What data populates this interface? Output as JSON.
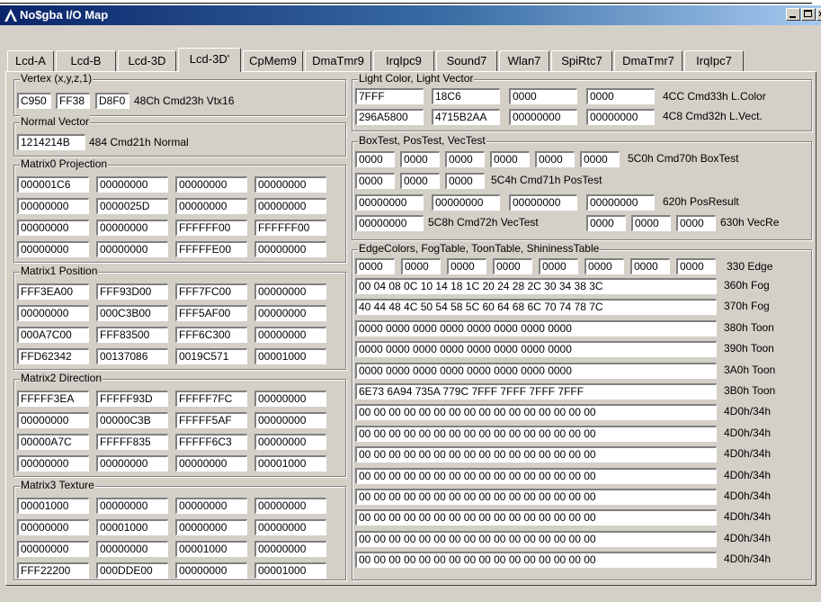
{
  "window": {
    "title": "No$gba I/O Map"
  },
  "tabs": [
    "Lcd-A",
    "Lcd-B",
    "Lcd-3D",
    "Lcd-3D'",
    "CpMem9",
    "DmaTmr9",
    "IrqIpc9",
    "Sound7",
    "Wlan7",
    "SpiRtc7",
    "DmaTmr7",
    "IrqIpc7"
  ],
  "active_tab": "Lcd-3D'",
  "vertex": {
    "title": "Vertex (x,y,z,1)",
    "values": [
      "C950",
      "FF38",
      "D8F0"
    ],
    "label": "48Ch Cmd23h Vtx16"
  },
  "normal": {
    "title": "Normal Vector",
    "value": "1214214B",
    "label": "484 Cmd21h Normal"
  },
  "matrix0": {
    "title": "Matrix0 Projection",
    "rows": [
      [
        "000001C6",
        "00000000",
        "00000000",
        "00000000"
      ],
      [
        "00000000",
        "0000025D",
        "00000000",
        "00000000"
      ],
      [
        "00000000",
        "00000000",
        "FFFFFF00",
        "FFFFFF00"
      ],
      [
        "00000000",
        "00000000",
        "FFFFFE00",
        "00000000"
      ]
    ]
  },
  "matrix1": {
    "title": "Matrix1 Position",
    "rows": [
      [
        "FFF3EA00",
        "FFF93D00",
        "FFF7FC00",
        "00000000"
      ],
      [
        "00000000",
        "000C3B00",
        "FFF5AF00",
        "00000000"
      ],
      [
        "000A7C00",
        "FFF83500",
        "FFF6C300",
        "00000000"
      ],
      [
        "FFD62342",
        "00137086",
        "0019C571",
        "00001000"
      ]
    ]
  },
  "matrix2": {
    "title": "Matrix2 Direction",
    "rows": [
      [
        "FFFFF3EA",
        "FFFFF93D",
        "FFFFF7FC",
        "00000000"
      ],
      [
        "00000000",
        "00000C3B",
        "FFFFF5AF",
        "00000000"
      ],
      [
        "00000A7C",
        "FFFFF835",
        "FFFFF6C3",
        "00000000"
      ],
      [
        "00000000",
        "00000000",
        "00000000",
        "00001000"
      ]
    ]
  },
  "matrix3": {
    "title": "Matrix3 Texture",
    "rows": [
      [
        "00001000",
        "00000000",
        "00000000",
        "00000000"
      ],
      [
        "00000000",
        "00001000",
        "00000000",
        "00000000"
      ],
      [
        "00000000",
        "00000000",
        "00001000",
        "00000000"
      ],
      [
        "FFF22200",
        "000DDE00",
        "00000000",
        "00001000"
      ]
    ]
  },
  "light": {
    "title": "Light Color, Light Vector",
    "row1": [
      "7FFF",
      "18C6",
      "0000",
      "0000"
    ],
    "row1_label": "4CC Cmd33h L.Color",
    "row2": [
      "296A5800",
      "4715B2AA",
      "00000000",
      "00000000"
    ],
    "row2_label": "4C8 Cmd32h L.Vect."
  },
  "boxtest": {
    "title": "BoxTest, PosTest, VecTest",
    "box": [
      "0000",
      "0000",
      "0000",
      "0000",
      "0000",
      "0000"
    ],
    "box_label": "5C0h Cmd70h BoxTest",
    "pos": [
      "0000",
      "0000",
      "0000"
    ],
    "pos_label": "5C4h Cmd71h PosTest",
    "posresult": [
      "00000000",
      "00000000",
      "00000000",
      "00000000"
    ],
    "posresult_label": "620h PosResult",
    "vec_in": "00000000",
    "vec_label": "5C8h Cmd72h VecTest",
    "vecresult": [
      "0000",
      "0000",
      "0000"
    ],
    "vecresult_label": "630h VecRe"
  },
  "edge": {
    "title": "EdgeColors, FogTable, ToonTable, ShininessTable",
    "colors": [
      "0000",
      "0000",
      "0000",
      "0000",
      "0000",
      "0000",
      "0000",
      "0000"
    ],
    "colors_label": "330 Edge",
    "rows": [
      {
        "value": "00 04 08 0C 10 14 18 1C 20 24 28 2C 30 34 38 3C",
        "label": "360h Fog"
      },
      {
        "value": "40 44 48 4C 50 54 58 5C 60 64 68 6C 70 74 78 7C",
        "label": "370h Fog"
      },
      {
        "value": "0000 0000 0000 0000 0000 0000 0000 0000",
        "label": "380h Toon"
      },
      {
        "value": "0000 0000 0000 0000 0000 0000 0000 0000",
        "label": "390h Toon"
      },
      {
        "value": "0000 0000 0000 0000 0000 0000 0000 0000",
        "label": "3A0h Toon"
      },
      {
        "value": "6E73 6A94 735A 779C 7FFF 7FFF 7FFF 7FFF",
        "label": "3B0h Toon"
      },
      {
        "value": "00 00 00 00 00 00 00 00 00 00 00 00 00 00 00 00",
        "label": "4D0h/34h"
      },
      {
        "value": "00 00 00 00 00 00 00 00 00 00 00 00 00 00 00 00",
        "label": "4D0h/34h"
      },
      {
        "value": "00 00 00 00 00 00 00 00 00 00 00 00 00 00 00 00",
        "label": "4D0h/34h"
      },
      {
        "value": "00 00 00 00 00 00 00 00 00 00 00 00 00 00 00 00",
        "label": "4D0h/34h"
      },
      {
        "value": "00 00 00 00 00 00 00 00 00 00 00 00 00 00 00 00",
        "label": "4D0h/34h"
      },
      {
        "value": "00 00 00 00 00 00 00 00 00 00 00 00 00 00 00 00",
        "label": "4D0h/34h"
      },
      {
        "value": "00 00 00 00 00 00 00 00 00 00 00 00 00 00 00 00",
        "label": "4D0h/34h"
      },
      {
        "value": "00 00 00 00 00 00 00 00 00 00 00 00 00 00 00 00",
        "label": "4D0h/34h"
      }
    ]
  }
}
